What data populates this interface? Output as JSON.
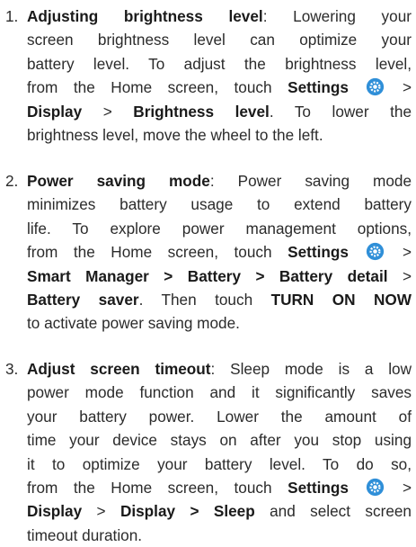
{
  "items": [
    {
      "number": "1.",
      "title": "Adjusting brightness level",
      "l1_rest": ": Lowering your",
      "l2": "screen brightness level can optimize your",
      "l3": "battery level. To adjust the brightness level,",
      "l4_pre": "from the Home screen, touch",
      "settings": "Settings",
      "gt": ">",
      "l5_a": "Display",
      "l5_b": "Brightness level",
      "l5_rest": ". To lower the",
      "l6": "brightness level, move the wheel to the left."
    },
    {
      "number": "2.",
      "title": "Power saving mode",
      "l1_rest": ": Power saving mode",
      "l2": "minimizes battery usage to extend battery",
      "l3": "life. To explore power management options,",
      "l4_pre": "from the Home screen, touch",
      "settings": "Settings",
      "gt": ">",
      "l5": "Smart Manager > Battery > Battery detail",
      "l6": "Battery saver",
      "l6_mid": ". Then touch",
      "l6_b": "TURN ON NOW",
      "l7": "to activate power saving mode."
    },
    {
      "number": "3.",
      "title": "Adjust screen timeout",
      "l1_rest": ": Sleep mode is a low",
      "l2": "power mode function and it significantly saves",
      "l3": "your battery power. Lower the amount of",
      "l4": "time your device stays on after you stop using",
      "l5": "it to optimize your battery level. To do so,",
      "l6_pre": "from the Home screen, touch",
      "settings": "Settings",
      "gt": ">",
      "l7_a": "Display",
      "l7_b": "Display > Sleep",
      "l7_rest": "and select screen",
      "l8": "timeout duration."
    }
  ],
  "icons": {
    "settings": "settings-gear-icon",
    "settings_color": "#2f8fd8"
  }
}
